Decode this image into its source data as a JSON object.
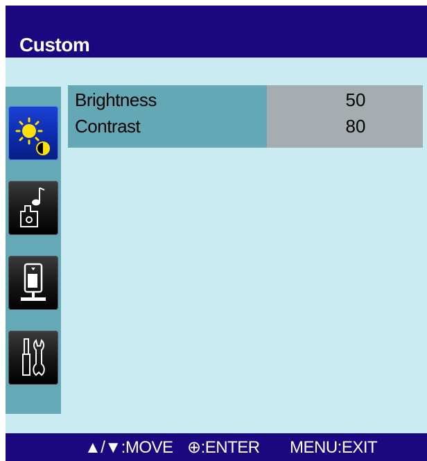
{
  "title": "Custom",
  "menu_icons": [
    {
      "name": "brightness-contrast-icon",
      "active": true
    },
    {
      "name": "audio-icon",
      "active": false
    },
    {
      "name": "image-setup-icon",
      "active": false
    },
    {
      "name": "tools-icon",
      "active": false
    }
  ],
  "settings": [
    {
      "label": "Brightness",
      "value": "50"
    },
    {
      "label": "Contrast",
      "value": "80"
    }
  ],
  "footer": {
    "move": "▲/▼:MOVE",
    "enter": "⊕:ENTER",
    "exit": "MENU:EXIT"
  },
  "colors": {
    "title_bar": "#1b0780",
    "background": "#c9ebf1",
    "sidebar": "#66a9b6",
    "label_column": "#64a7b5",
    "value_column": "#a5adb0",
    "active_tile": "#0a2aa8"
  }
}
